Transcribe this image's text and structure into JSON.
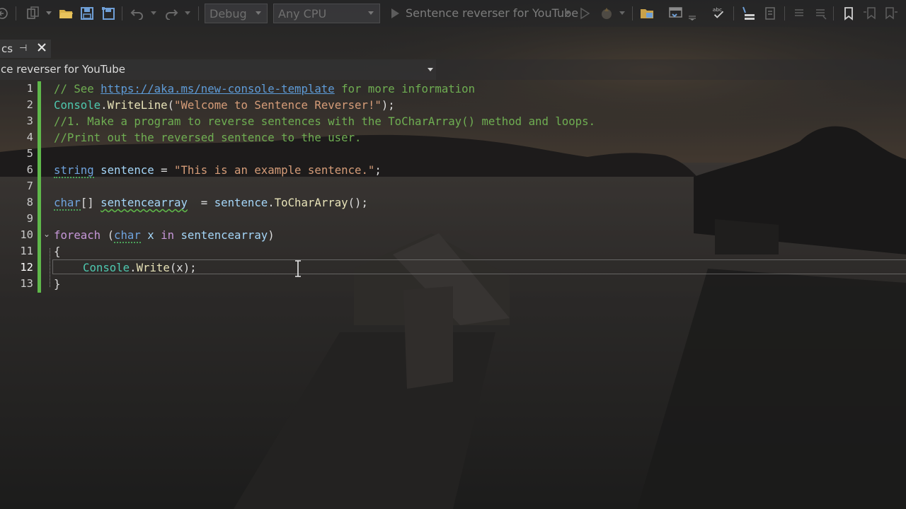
{
  "toolbar": {
    "configuration": "Debug",
    "platform": "Any CPU",
    "start_target": "Sentence reverser for YouTube",
    "icons": [
      "back-icon",
      "solution-icon",
      "open-folder-icon",
      "save-icon",
      "save-all-icon",
      "undo-icon",
      "redo-icon",
      "start-icon",
      "start-without-debugging-icon",
      "hot-reload-icon",
      "solution-explorer-icon",
      "browser-link-icon",
      "spell-check-icon",
      "format-icon",
      "toggle-comment-icon",
      "bookmark-icon"
    ]
  },
  "tab": {
    "name": "cs"
  },
  "navbar": {
    "project": "ce reverser for YouTube"
  },
  "editor": {
    "current_line": 12,
    "lines": [
      {
        "n": "1"
      },
      {
        "n": "2"
      },
      {
        "n": "3"
      },
      {
        "n": "4"
      },
      {
        "n": "5"
      },
      {
        "n": "6"
      },
      {
        "n": "7"
      },
      {
        "n": "8"
      },
      {
        "n": "9"
      },
      {
        "n": "10"
      },
      {
        "n": "11"
      },
      {
        "n": "12"
      },
      {
        "n": "13"
      }
    ],
    "code": {
      "l1_a": "// See ",
      "l1_link": "https://aka.ms/new-console-template",
      "l1_b": " for more information",
      "l2_type": "Console",
      "l2_dot": ".",
      "l2_method": "WriteLine",
      "l2_open": "(",
      "l2_str": "\"Welcome to Sentence Reverser!\"",
      "l2_close": ");",
      "l3": "//1. Make a program to reverse sentences with the ToCharArray() method and loops.",
      "l4": "//Print out the reversed sentence to the user.",
      "l6_kw": "string",
      "l6_var": "sentence",
      "l6_eq": " = ",
      "l6_str": "\"This is an example sentence.\"",
      "l6_end": ";",
      "l8_kw": "char",
      "l8_br": "[] ",
      "l8_var": "sentencearray",
      "l8_eq": "  = ",
      "l8_var2": "sentence",
      "l8_dot": ".",
      "l8_method": "ToCharArray",
      "l8_end": "();",
      "l10_ctl": "foreach",
      "l10_open": " (",
      "l10_kw": "char",
      "l10_x": " x ",
      "l10_in": "in",
      "l10_var": " sentencearray",
      "l10_close": ")",
      "l11": "{",
      "l12_type": "Console",
      "l12_dot": ".",
      "l12_method": "Write",
      "l12_args": "(x);",
      "l13": "}"
    }
  },
  "colors": {
    "comment": "#6fae52",
    "type": "#4ec9b0",
    "keyword": "#6fa3dd",
    "control": "#c797d9",
    "string": "#d69d79",
    "method": "#e8e3b8",
    "variable": "#a5d6f8",
    "change_bar": "#5fb84a"
  }
}
